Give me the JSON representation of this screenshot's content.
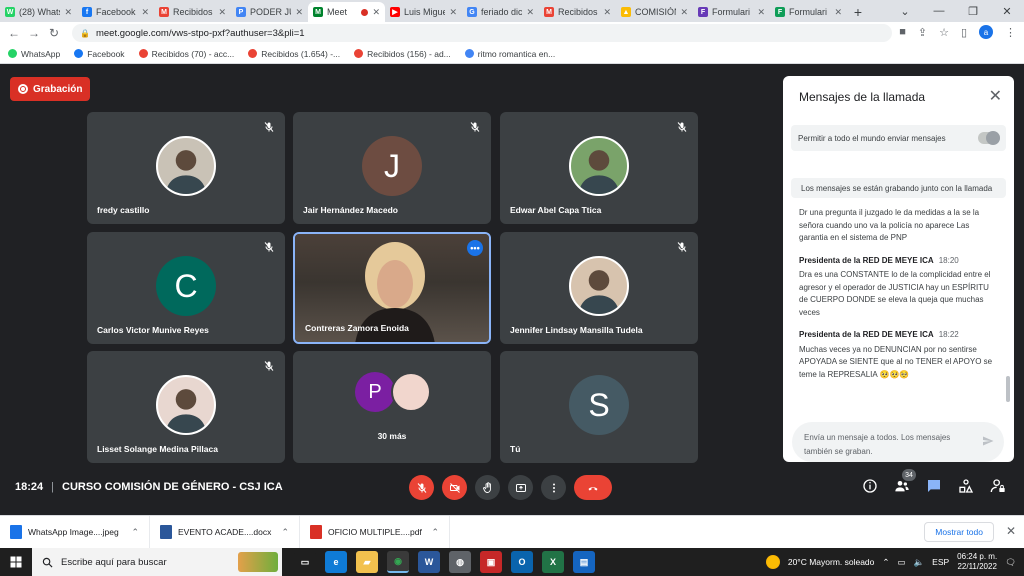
{
  "browser": {
    "tabs": [
      {
        "title": "(28) Whats",
        "color": "#25d366",
        "glyph": "W"
      },
      {
        "title": "Facebook",
        "color": "#1877f2",
        "glyph": "f"
      },
      {
        "title": "Recibidos",
        "color": "#ea4335",
        "glyph": "M"
      },
      {
        "title": "PODER JU",
        "color": "#4285f4",
        "glyph": "P"
      },
      {
        "title": "Meet",
        "color": "#00832d",
        "glyph": "M",
        "active": true,
        "recording": true
      },
      {
        "title": "Luis Migue",
        "color": "#ff0000",
        "glyph": "▶"
      },
      {
        "title": "feriado dic",
        "color": "#4285f4",
        "glyph": "G"
      },
      {
        "title": "Recibidos",
        "color": "#ea4335",
        "glyph": "M"
      },
      {
        "title": "COMISIÓN",
        "color": "#fbbc04",
        "glyph": "▲"
      },
      {
        "title": "Formulari",
        "color": "#673ab7",
        "glyph": "F"
      },
      {
        "title": "Formulari",
        "color": "#0f9d58",
        "glyph": "F"
      }
    ],
    "url": "meet.google.com/vws-stpo-pxf?authuser=3&pli=1",
    "profile_initial": "a",
    "bookmarks": [
      {
        "label": "WhatsApp",
        "color": "#25d366"
      },
      {
        "label": "Facebook",
        "color": "#1877f2"
      },
      {
        "label": "Recibidos (70) - acc...",
        "color": "#ea4335"
      },
      {
        "label": "Recibidos (1.654) -...",
        "color": "#ea4335"
      },
      {
        "label": "Recibidos (156) - ad...",
        "color": "#ea4335"
      },
      {
        "label": "ritmo romantica en...",
        "color": "#4285f4"
      }
    ]
  },
  "meet": {
    "recording_label": "Grabación",
    "participants": [
      {
        "name": "fredy castillo",
        "type": "photo",
        "color": "#c9c2b6"
      },
      {
        "name": "Jair Hernández Macedo",
        "type": "letter",
        "letter": "J",
        "color": "#6d4c41"
      },
      {
        "name": "Edwar Abel Capa Ttica",
        "type": "photo",
        "color": "#7aa36a"
      },
      {
        "name": "Carlos Victor Munive Reyes",
        "type": "letter",
        "letter": "C",
        "color": "#00695c"
      },
      {
        "name": "Contreras Zamora Enoida",
        "type": "video",
        "color": "#4b4039"
      },
      {
        "name": "Jennifer Lindsay Mansilla Tudela",
        "type": "photo",
        "color": "#d7c3ae"
      },
      {
        "name": "Lisset Solange Medina Pillaca",
        "type": "photo",
        "color": "#e8d7d0"
      },
      {
        "name": "30 más",
        "type": "group",
        "letter": "P",
        "color": "#7b1fa2"
      },
      {
        "name": "Tú",
        "type": "letter",
        "letter": "S",
        "color": "#455a64"
      }
    ],
    "meeting_time": "18:24",
    "meeting_title": "CURSO COMISIÓN DE GÉNERO - CSJ ICA",
    "participant_count": "34"
  },
  "chat": {
    "title": "Mensajes de la llamada",
    "allow_label": "Permitir a todo el mundo enviar mensajes",
    "recording_notice": "Los mensajes se están grabando junto con la llamada",
    "messages": [
      {
        "sender": "",
        "time": "",
        "text": "Dr una pregunta il juzgado  le da medidas a la se la señora  cuando uno va la policía no aparece Las garantia en el sistema de PNP"
      },
      {
        "sender": "Presidenta de la RED DE MEYE ICA",
        "time": "18:20",
        "text": "Dra es una CONSTANTE lo de la complicidad entre el agresor y el operador de JUSTICIA hay un ESPÍRITU de CUERPO DONDE se eleva la queja que muchas veces"
      },
      {
        "sender": "Presidenta de la RED DE MEYE ICA",
        "time": "18:22",
        "text": "Muchas veces  ya  no DENUNCIAN por no sentirse APOYADA se SIENTE que al no TENER el APOYO se teme la REPRESALIA 🥺🥺🥺"
      }
    ],
    "compose_placeholder": "Envía un mensaje a todos. Los mensajes también se graban."
  },
  "downloads": {
    "items": [
      {
        "name": "WhatsApp Image....jpeg",
        "color": "#1a73e8"
      },
      {
        "name": "EVENTO ACADE....docx",
        "color": "#2b579a"
      },
      {
        "name": "OFICIO MULTIPLE....pdf",
        "color": "#d93025"
      }
    ],
    "show_all": "Mostrar todo"
  },
  "taskbar": {
    "search_placeholder": "Escribe aquí para buscar",
    "apps": [
      {
        "name": "task-view",
        "color": "#1f1f1f",
        "glyph": "▭"
      },
      {
        "name": "edge",
        "color": "#0f7bd6",
        "glyph": "e"
      },
      {
        "name": "explorer",
        "color": "#f2c14e",
        "glyph": "▰"
      },
      {
        "name": "chrome",
        "color": "#34a853",
        "glyph": "◉",
        "active": true
      },
      {
        "name": "word",
        "color": "#2b579a",
        "glyph": "W"
      },
      {
        "name": "app",
        "color": "#5f6368",
        "glyph": "◍"
      },
      {
        "name": "app-red",
        "color": "#c62828",
        "glyph": "▣"
      },
      {
        "name": "outlook",
        "color": "#0a64ad",
        "glyph": "O"
      },
      {
        "name": "excel",
        "color": "#217346",
        "glyph": "X"
      },
      {
        "name": "app-blue",
        "color": "#1565c0",
        "glyph": "▤"
      }
    ],
    "weather": "20°C  Mayorm. soleado",
    "language": "ESP",
    "time": "06:24 p. m.",
    "date": "22/11/2022"
  }
}
